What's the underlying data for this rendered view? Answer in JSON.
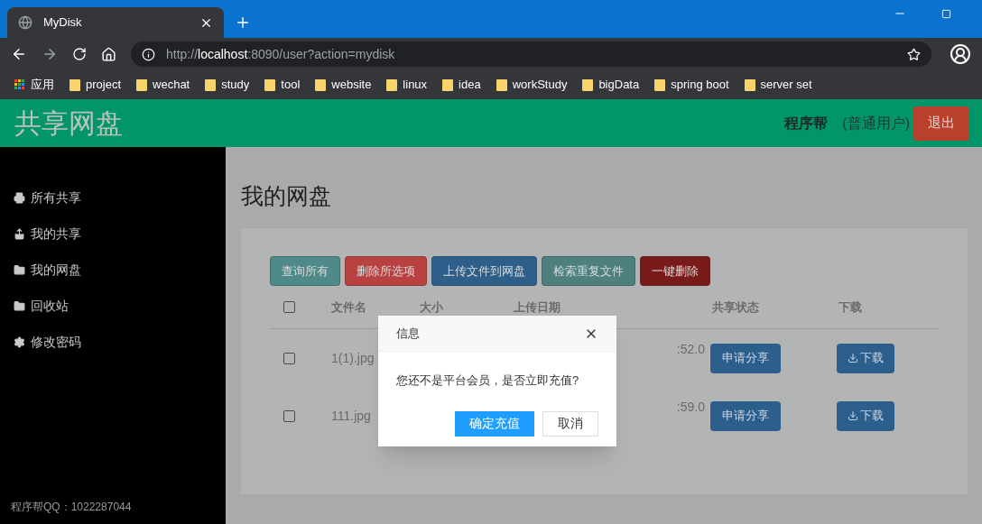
{
  "browser": {
    "tab_title": "MyDisk",
    "url": "http://**localhost**:8090/user?action=mydisk",
    "bookmarks": [
      "应用",
      "project",
      "wechat",
      "study",
      "tool",
      "website",
      "linux",
      "idea",
      "workStudy",
      "bigData",
      "spring boot",
      "server set"
    ]
  },
  "header": {
    "logo": "共享网盘",
    "username": "程序帮",
    "role": "(普通用户)",
    "logout": "退出"
  },
  "sidebar": {
    "items": [
      {
        "label": "所有共享"
      },
      {
        "label": "我的共享"
      },
      {
        "label": "我的网盘"
      },
      {
        "label": "回收站"
      },
      {
        "label": "修改密码"
      }
    ],
    "footer": "程序帮QQ：1022287044"
  },
  "main": {
    "title": "我的网盘",
    "toolbar": [
      {
        "label": "查询所有",
        "color": "#4e8a88"
      },
      {
        "label": "删除所选项",
        "color": "#b9413f"
      },
      {
        "label": "上传文件到网盘",
        "color": "#2d5f8a"
      },
      {
        "label": "检索重复文件",
        "color": "#4e8080"
      },
      {
        "label": "一键删除",
        "color": "#7a1b1b"
      }
    ],
    "table": {
      "select_all": {
        "checked": false
      },
      "columns": [
        "文件名",
        "大小",
        "上传日期",
        "共享状态",
        "下载"
      ],
      "rows": [
        {
          "checked": false,
          "name": "1(1).jpg",
          "date": ":52.0",
          "share": "申请分享",
          "download": "下载"
        },
        {
          "checked": false,
          "name": "111.jpg",
          "date": ":59.0",
          "share": "申请分享",
          "download": "下载"
        }
      ]
    }
  },
  "dialog": {
    "title": "信息",
    "message": "您还不是平台会员，是否立即充值?",
    "confirm": "确定充值",
    "cancel": "取消"
  }
}
